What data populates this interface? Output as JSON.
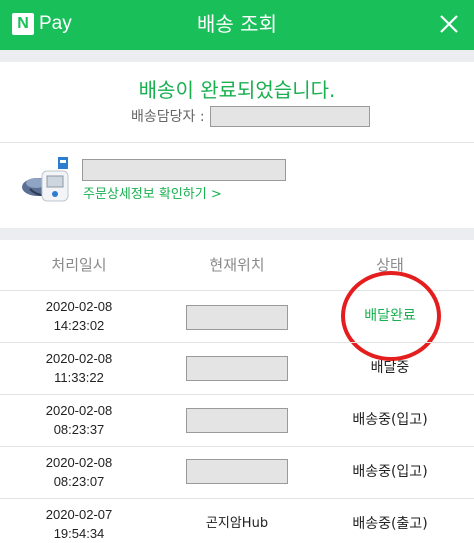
{
  "header": {
    "logo_mark": "N",
    "logo_text": "Pay",
    "title": "배송 조회",
    "close_icon": "close-icon",
    "color": "#19c05a"
  },
  "delivery": {
    "status_message": "배송이 완료되었습니다.",
    "courier_label": "배송담당자 :"
  },
  "product": {
    "image_icon": "blood-pressure-monitor-image",
    "order_link": "주문상세정보 확인하기 >"
  },
  "table": {
    "headers": [
      "처리일시",
      "현재위치",
      "상태"
    ],
    "rows": [
      {
        "date": "2020-02-08",
        "time": "14:23:02",
        "location": "",
        "status": "배달완료"
      },
      {
        "date": "2020-02-08",
        "time": "11:33:22",
        "location": "",
        "status": "배달중"
      },
      {
        "date": "2020-02-08",
        "time": "08:23:37",
        "location": "",
        "status": "배송중(입고)"
      },
      {
        "date": "2020-02-08",
        "time": "08:23:07",
        "location": "",
        "status": "배송중(입고)"
      },
      {
        "date": "2020-02-07",
        "time": "19:54:34",
        "location": "곤지암Hub",
        "status": "배송중(출고)"
      }
    ]
  },
  "colors": {
    "accent_green": "#19b050",
    "highlight_circle": "#e41e1e"
  }
}
